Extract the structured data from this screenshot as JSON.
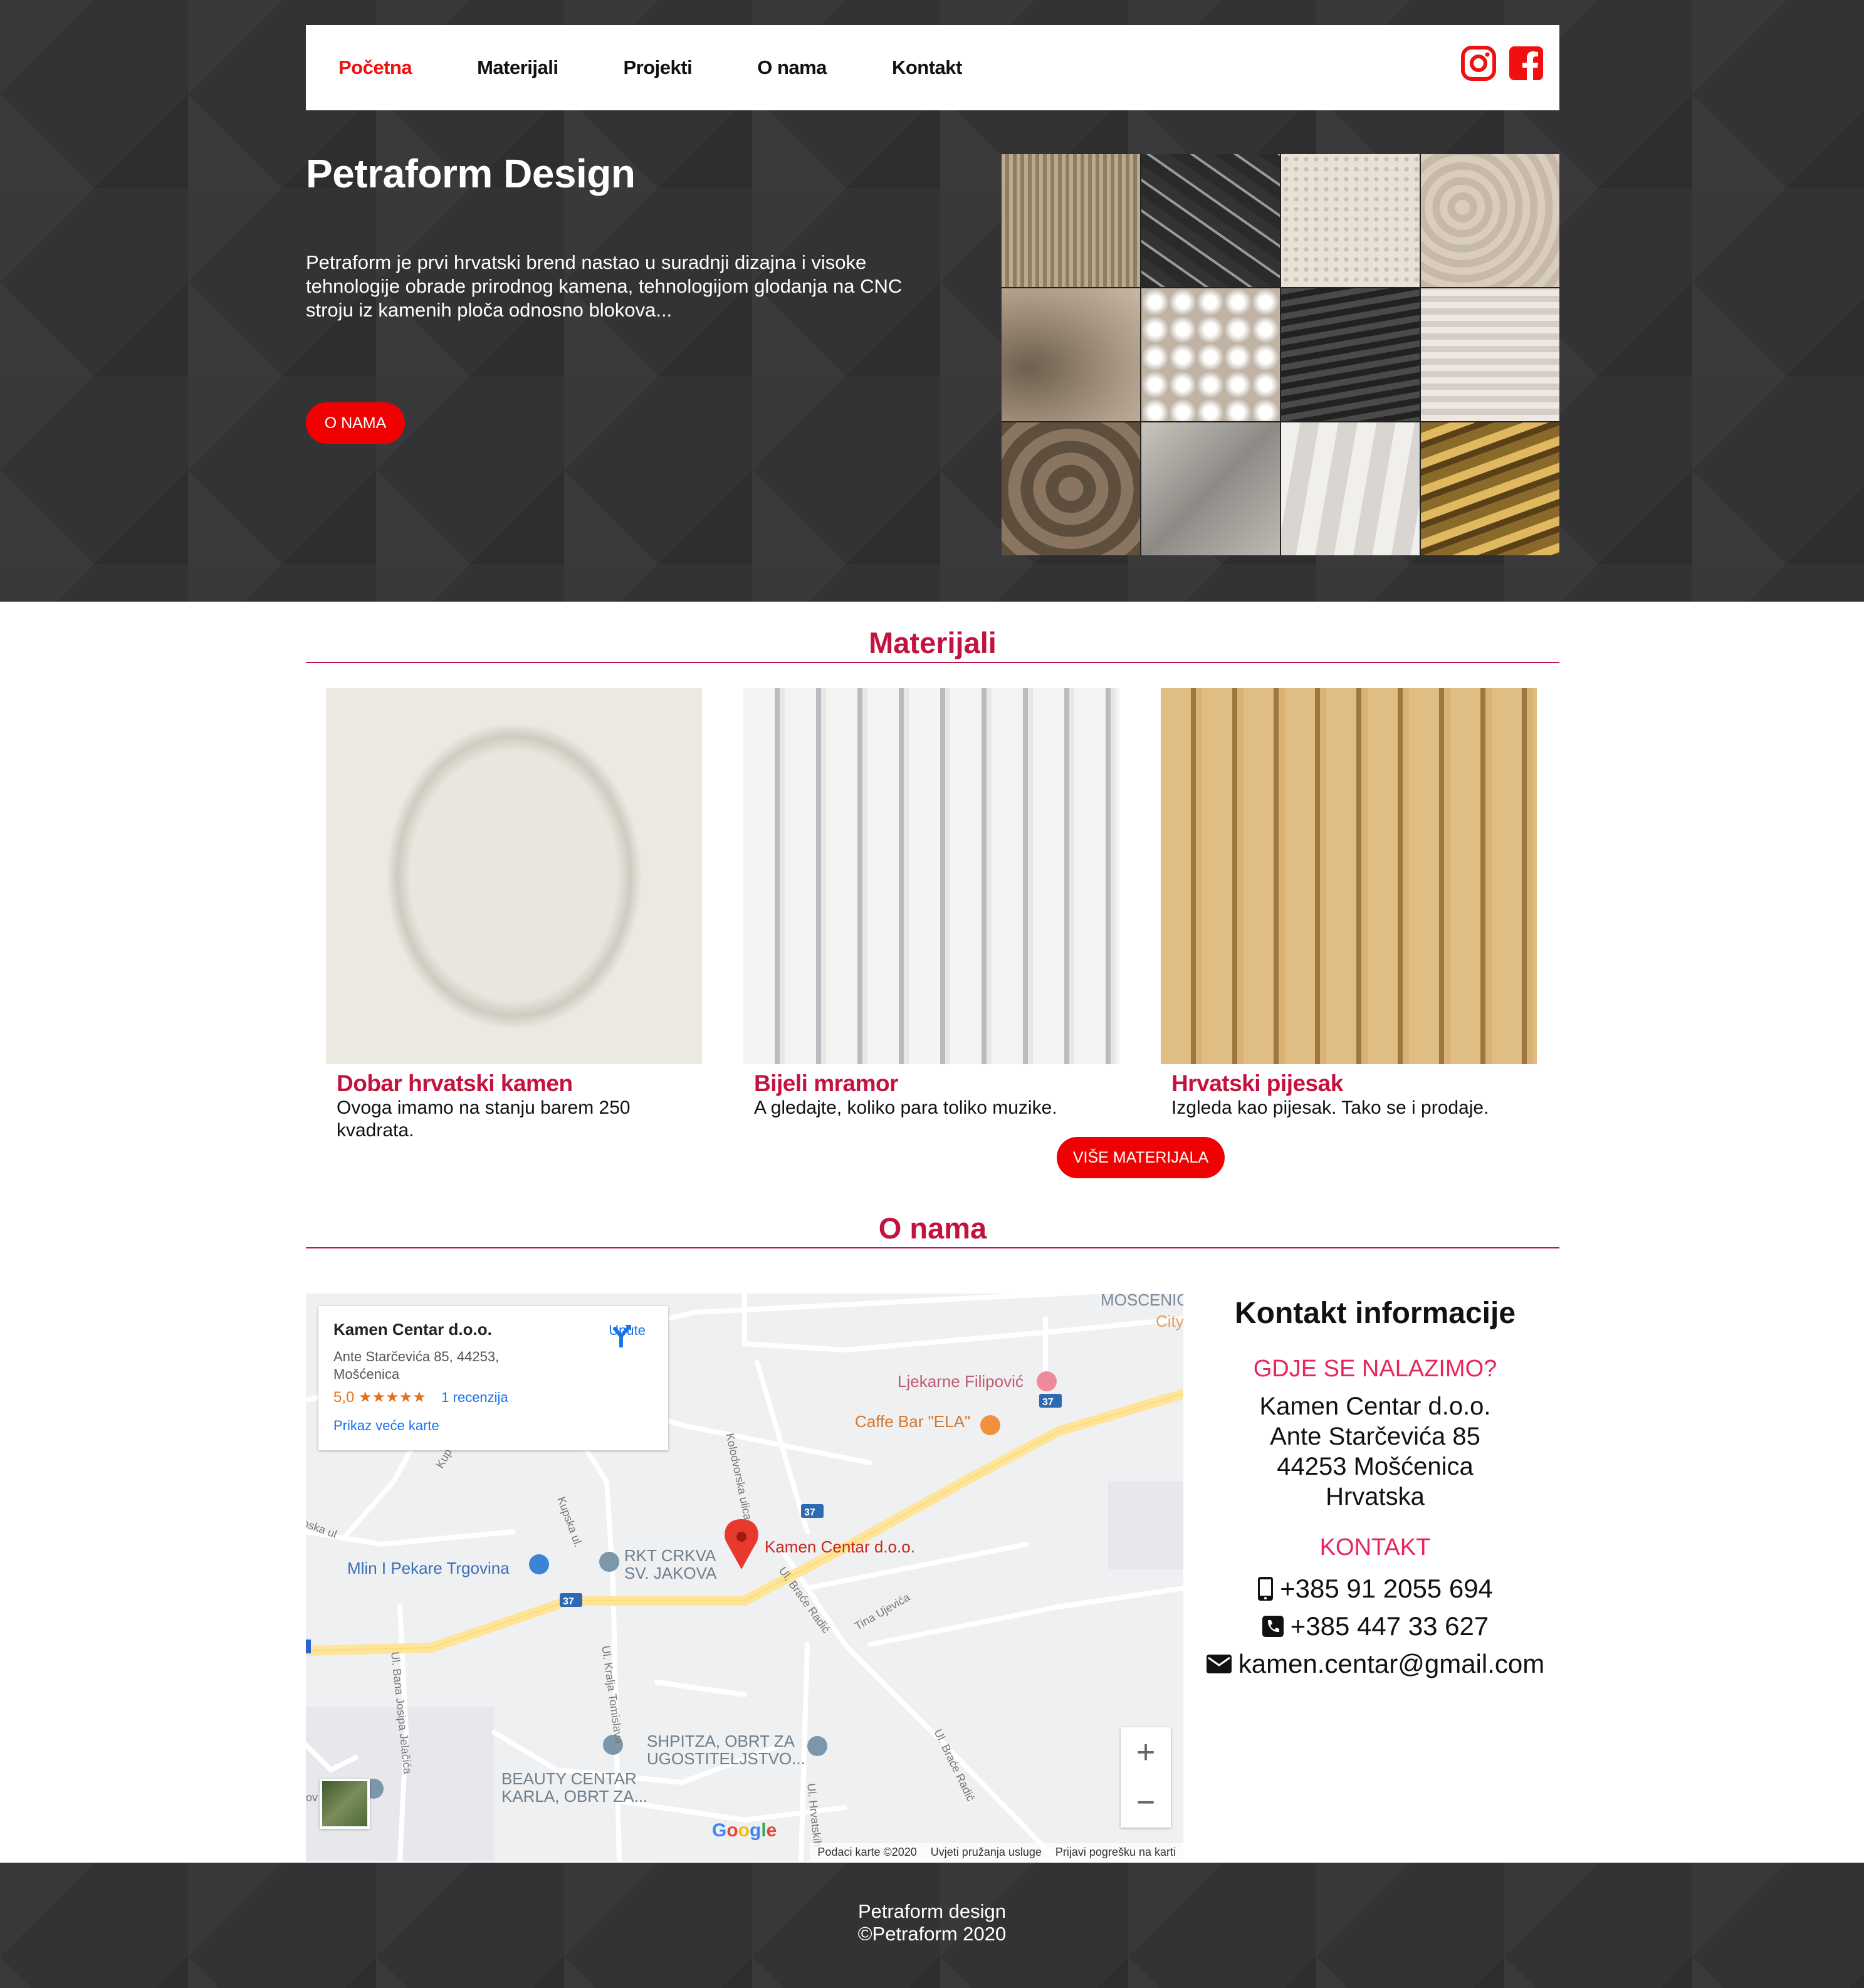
{
  "nav": {
    "items": [
      "Početna",
      "Materijali",
      "Projekti",
      "O nama",
      "Kontakt"
    ],
    "active": "Početna",
    "social": [
      {
        "icon": "instagram-icon"
      },
      {
        "icon": "facebook-icon"
      }
    ]
  },
  "hero": {
    "title": "Petraform Design",
    "text": "Petraform je prvi hrvatski brend nastao u suradnji dizajna i visoke tehnologije obrade prirodnog kamena, tehnologijom glodanja na CNC stroju iz kamenih ploča odnosno blokova...",
    "button": "O NAMA"
  },
  "materials": {
    "title": "Materijali",
    "cards": [
      {
        "title": "Dobar hrvatski kamen",
        "desc": "Ovoga imamo na stanju barem 250 kvadrata."
      },
      {
        "title": "Bijeli mramor",
        "desc": "A gledajte, koliko para toliko muzike."
      },
      {
        "title": "Hrvatski pijesak",
        "desc": "Izgleda kao pijesak. Tako se i prodaje."
      }
    ],
    "more_button": "VIŠE MATERIJALA"
  },
  "about": {
    "title": "O nama"
  },
  "map": {
    "card_title": "Kamen Centar d.o.o.",
    "card_address": "Ante Starčevića 85, 44253, Mošćenica",
    "rating": "5,0 ★★★★★",
    "reviews": "1 recenzija",
    "larger_map": "Prikaz veće karte",
    "directions": "Upute",
    "labels": {
      "mosc": "MOSCENIC",
      "city": "City",
      "ljekarne": "Ljekarne Filipović",
      "caffe": "Caffe Bar \"ELA\"",
      "kamen": "Kamen Centar d.o.o.",
      "mlin": "Mlin I Pekare Trgovina",
      "rkt": "RKT CRKVA\nSV. JAKOVA",
      "shpitza": "SHPITZA, OBRT ZA\nUGOSTITELJSTVO...",
      "beauty": "BEAUTY CENTAR\nKARLA, OBRT ZA...",
      "kolodvorska": "Kolodvorska ulica",
      "kupska": "Kupska ul.",
      "kralja": "Ul. Kralja Tomislava",
      "bana": "Ul. Bana Josipa Jelačića",
      "brace": "Ul. Braće Radić",
      "brace2": "Ul. Braće Radić",
      "tina": "Tina Ujevića",
      "oska": "oska ul",
      "kup": "Kup",
      "ov": "ov",
      "hrvatskih": "Ul. Hrvatskih",
      "road37": "37"
    },
    "google": "Google",
    "footer": [
      "Podaci karte ©2020",
      "Uvjeti pružanja usluge",
      "Prijavi pogrešku na karti"
    ]
  },
  "contact": {
    "title": "Kontakt informacije",
    "where_label": "GDJE SE NALAZIMO?",
    "address": [
      "Kamen Centar d.o.o.",
      "Ante Starčevića 85",
      "44253 Mošćenica",
      "Hrvatska"
    ],
    "contact_label": "KONTAKT",
    "mobile": "+385 91 2055 694",
    "phone": "+385 447 33 627",
    "email": "kamen.centar@gmail.com"
  },
  "footer": {
    "line1": "Petraform design",
    "line2": "©Petraform 2020"
  },
  "colors": {
    "accent": "#c3123f",
    "button": "#f00000",
    "dark": "#333335"
  }
}
